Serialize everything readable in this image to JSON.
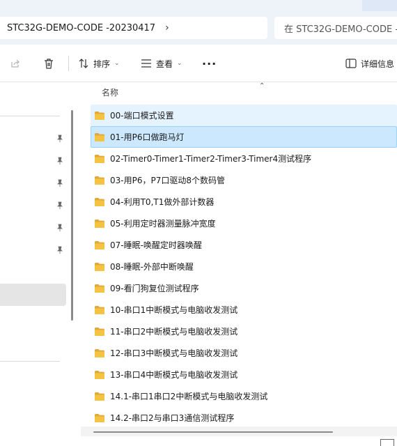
{
  "address": {
    "path_segment": "STC32G-DEMO-CODE -20230417",
    "chevron": "›",
    "search_placeholder": "在 STC32G-DEMO-CODE -"
  },
  "toolbar": {
    "sort_label": "排序",
    "view_label": "查看",
    "more_label": "···",
    "details_label": "详细信息"
  },
  "list": {
    "column_name": "名称",
    "items": [
      {
        "label": "00-端口模式设置",
        "state": "hover"
      },
      {
        "label": "01-用P6口做跑马灯",
        "state": "selected"
      },
      {
        "label": "02-Timer0-Timer1-Timer2-Timer3-Timer4测试程序",
        "state": ""
      },
      {
        "label": "03-用P6，P7口驱动8个数码管",
        "state": ""
      },
      {
        "label": "04-利用T0,T1做外部计数器",
        "state": ""
      },
      {
        "label": "05-利用定时器测量脉冲宽度",
        "state": ""
      },
      {
        "label": "07-睡眠-唤醒定时器唤醒",
        "state": ""
      },
      {
        "label": "08-睡眠-外部中断唤醒",
        "state": ""
      },
      {
        "label": "09-看门狗复位测试程序",
        "state": ""
      },
      {
        "label": "10-串口1中断模式与电脑收发测试",
        "state": ""
      },
      {
        "label": "11-串口2中断模式与电脑收发测试",
        "state": ""
      },
      {
        "label": "12-串口3中断模式与电脑收发测试",
        "state": ""
      },
      {
        "label": "13-串口4中断模式与电脑收发测试",
        "state": ""
      },
      {
        "label": "14.1-串口1串口2中断模式与电脑收发测试",
        "state": ""
      },
      {
        "label": "14.2-串口2与串口3通信测试程序",
        "state": ""
      }
    ]
  },
  "colors": {
    "folder": "#f5c342",
    "hover": "#e5f3ff",
    "selected": "#cce8ff",
    "selected_border": "#99d1ff"
  }
}
